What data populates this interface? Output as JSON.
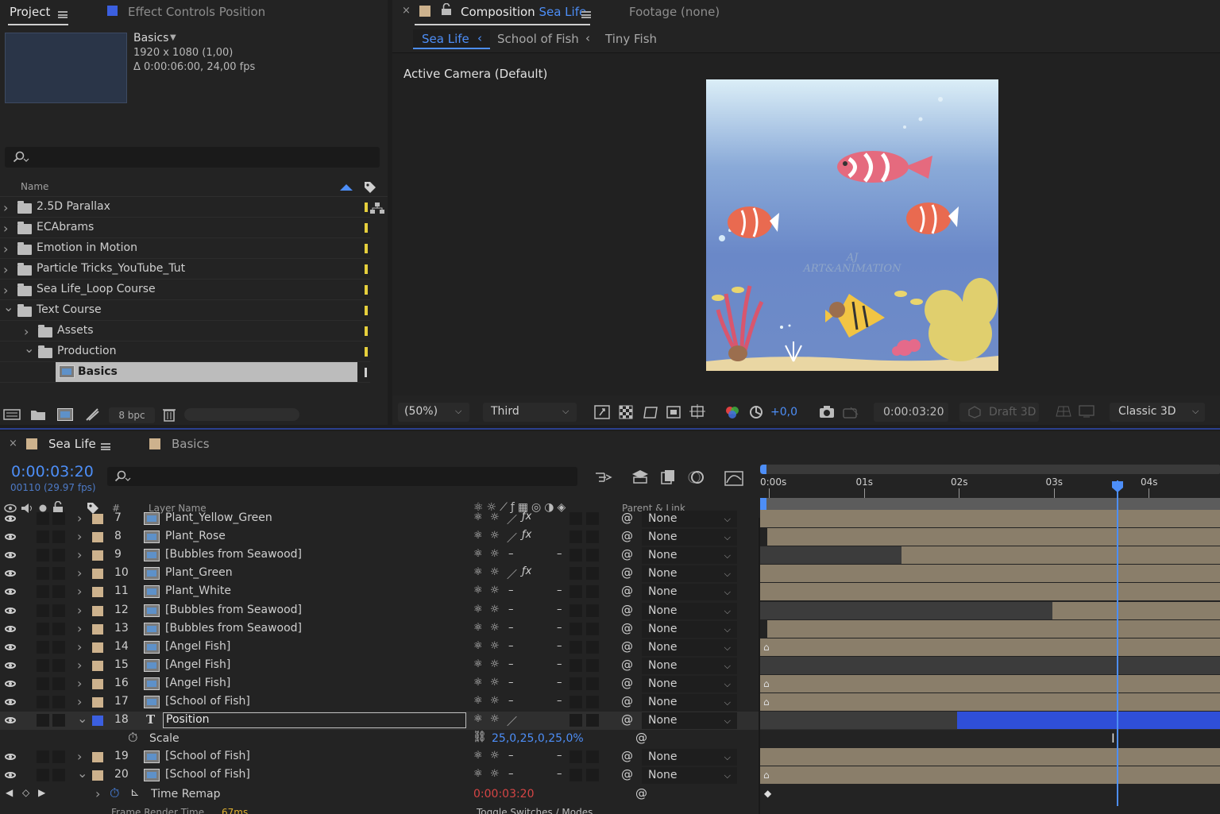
{
  "project": {
    "tab_label": "Project",
    "effect_controls_label": "Effect Controls Position",
    "selected_name": "Basics",
    "selected_dims": "1920 x 1080 (1,00)",
    "selected_duration": "Δ 0:00:06:00, 24,00 fps",
    "column_name": "Name",
    "items": [
      {
        "label": "2.5D Parallax",
        "expanded": false,
        "indent": 0
      },
      {
        "label": "ECAbrams",
        "expanded": false,
        "indent": 0
      },
      {
        "label": "Emotion in Motion",
        "expanded": false,
        "indent": 0
      },
      {
        "label": "Particle Tricks_YouTube_Tut",
        "expanded": false,
        "indent": 0
      },
      {
        "label": "Sea Life_Loop Course",
        "expanded": false,
        "indent": 0
      },
      {
        "label": "Text Course",
        "expanded": true,
        "indent": 0
      },
      {
        "label": "Assets",
        "expanded": false,
        "indent": 1
      },
      {
        "label": "Production",
        "expanded": true,
        "indent": 1
      },
      {
        "label": "Basics",
        "expanded": false,
        "indent": 2,
        "selected": true
      }
    ],
    "bpc": "8 bpc"
  },
  "composition": {
    "tab_prefix": "Composition",
    "tab_name": "Sea Life",
    "footage_label": "Footage (none)",
    "breadcrumbs": [
      "Sea Life",
      "School of Fish",
      "Tiny Fish"
    ],
    "camera_label": "Active Camera (Default)",
    "watermark_line1": "AJ",
    "watermark_line2": "ART&ANIMATION",
    "zoom": "(50%)",
    "resolution": "Third",
    "exposure": "+0,0",
    "timecode": "0:00:03:20",
    "draft3d": "Draft 3D",
    "renderer": "Classic 3D"
  },
  "timeline": {
    "tab_name": "Sea Life",
    "tab2_name": "Basics",
    "current_time": "0:00:03:20",
    "frame_info": "00110 (29.97 fps)",
    "col_hash": "#",
    "col_layer_name": "Layer Name",
    "col_parent": "Parent & Link",
    "ruler": [
      "0:00s",
      "01s",
      "02s",
      "03s",
      "04s"
    ],
    "layers": [
      {
        "num": "7",
        "name": "Plant_Yellow_Green",
        "type": "comp",
        "parent": "None",
        "fx": true
      },
      {
        "num": "8",
        "name": "Plant_Rose",
        "type": "comp",
        "parent": "None",
        "fx": true
      },
      {
        "num": "9",
        "name": "[Bubbles from Seawood]",
        "type": "comp",
        "parent": "None",
        "fx": false
      },
      {
        "num": "10",
        "name": "Plant_Green",
        "type": "comp",
        "parent": "None",
        "fx": true
      },
      {
        "num": "11",
        "name": "Plant_White",
        "type": "comp",
        "parent": "None",
        "fx": false
      },
      {
        "num": "12",
        "name": "[Bubbles from Seawood]",
        "type": "comp",
        "parent": "None",
        "fx": false
      },
      {
        "num": "13",
        "name": "[Bubbles from Seawood]",
        "type": "comp",
        "parent": "None",
        "fx": false
      },
      {
        "num": "14",
        "name": "[Angel Fish]",
        "type": "comp",
        "parent": "None",
        "fx": false
      },
      {
        "num": "15",
        "name": "[Angel Fish]",
        "type": "comp",
        "parent": "None",
        "fx": false
      },
      {
        "num": "16",
        "name": "[Angel Fish]",
        "type": "comp",
        "parent": "None",
        "fx": false
      },
      {
        "num": "17",
        "name": "[School of Fish]",
        "type": "comp",
        "parent": "None",
        "fx": false
      },
      {
        "num": "18",
        "name": "Position",
        "type": "text",
        "parent": "None",
        "fx": false,
        "selected": true
      }
    ],
    "scale_label": "Scale",
    "scale_value": "25,0,25,0,25,0%",
    "layers2": [
      {
        "num": "19",
        "name": "[School of Fish]",
        "parent": "None"
      },
      {
        "num": "20",
        "name": "[School of Fish]",
        "parent": "None"
      }
    ],
    "time_remap_label": "Time Remap",
    "time_remap_value": "0:00:03:20",
    "footer_left": "Frame Render Time",
    "footer_left_value": "67ms",
    "footer_mid": "Toggle Switches / Modes",
    "playhead_seconds": 3.67,
    "work_area_blue_end_seconds": 2.08
  },
  "colors": {
    "accent_blue": "#4d8ef7",
    "label_tan": "#cdb28d",
    "layer_bar": "#8a7e6a",
    "selected_bar": "#2f4fd8"
  }
}
